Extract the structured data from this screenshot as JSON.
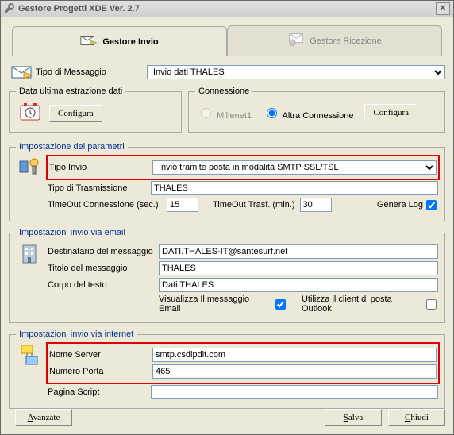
{
  "window": {
    "title": "Gestore Progetti XDE Ver. 2.7"
  },
  "tabs": {
    "send": "Gestore Invio",
    "receive": "Gestore Ricezione"
  },
  "tipoMsg": {
    "label": "Tipo di Messaggio",
    "value": "Invio dati THALES"
  },
  "extract": {
    "legend": "Data ultima estrazione dati",
    "btn": "Configura"
  },
  "conn": {
    "legend": "Connessione",
    "opt1": "Millenet1",
    "opt2": "Altra Connessione",
    "btn": "Configura"
  },
  "params": {
    "legend": "Impostazione dei parametri",
    "tipoInvio": {
      "label": "Tipo Invio",
      "value": "Invio tramite posta in modalità SMTP SSL/TSL"
    },
    "tipoTrasm": {
      "label": "Tipo di Trasmissione",
      "value": "THALES"
    },
    "toConn": {
      "label": "TimeOut Connessione (sec.)",
      "value": "15"
    },
    "toTrasf": {
      "label": "TimeOut Trasf. (min.)",
      "value": "30"
    },
    "genLog": {
      "label": "Genera Log"
    }
  },
  "email": {
    "legend": "Impostazioni invio via email",
    "dest": {
      "label": "Destinatario del messaggio",
      "value": "DATI.THALES-IT@santesurf.net"
    },
    "titolo": {
      "label": "Titolo del messaggio",
      "value": "THALES"
    },
    "corpo": {
      "label": "Corpo del testo",
      "value": "Dati THALES"
    },
    "vis": "Visualizza Il messaggio Email",
    "outlook": "Utilizza il client di posta Outlook"
  },
  "internet": {
    "legend": "Impostazioni invio via internet",
    "server": {
      "label": "Nome Server",
      "value": "smtp.csdlpdit.com"
    },
    "porta": {
      "label": "Numero Porta",
      "value": "465"
    },
    "script": {
      "label": "Pagina Script",
      "value": ""
    }
  },
  "buttons": {
    "adv": "Avanzate",
    "save": "Salva",
    "close": "Chiudi"
  }
}
